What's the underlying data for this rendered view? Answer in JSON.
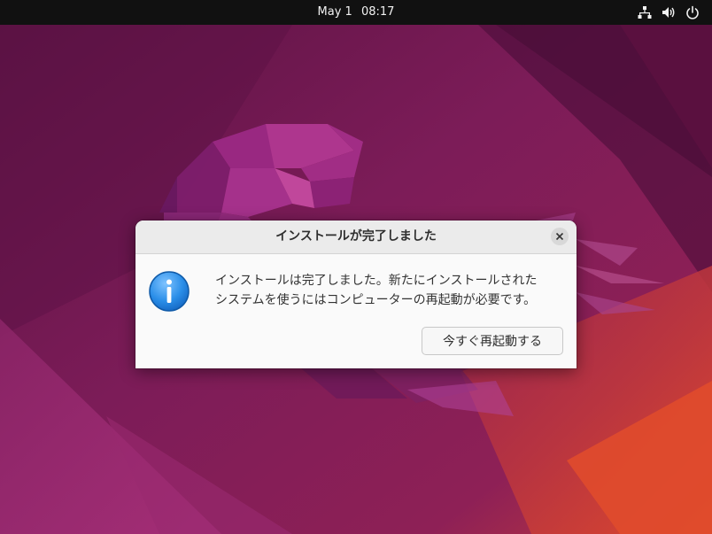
{
  "topbar": {
    "date": "May 1",
    "time": "08:17",
    "tray_icons": [
      "network-icon",
      "volume-icon",
      "power-icon"
    ]
  },
  "dialog": {
    "title": "インストールが完了しました",
    "message_line1": "インストールは完了しました。新たにインストールされた",
    "message_line2": "システムを使うにはコンピューターの再起動が必要です。",
    "restart_button_label": "今すぐ再起動する",
    "icon": "info-icon"
  },
  "colors": {
    "topbar": "#111111",
    "wallpaper_dark": "#4a0f38",
    "wallpaper_mid": "#7a1d55",
    "wallpaper_accent": "#d9452c",
    "dialog_bg": "#fafafa",
    "titlebar_bg": "#ebebeb",
    "info_blue": "#2a8ee8"
  }
}
